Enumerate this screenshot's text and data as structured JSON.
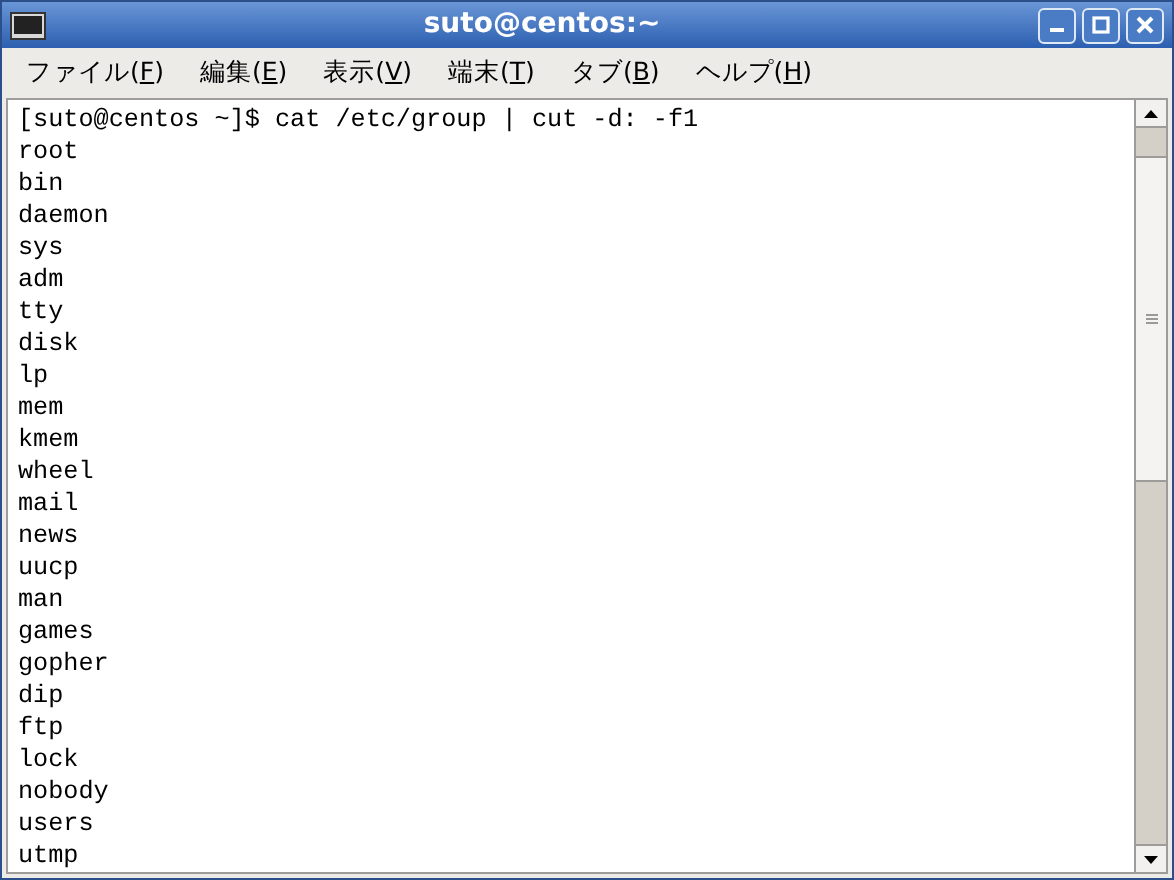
{
  "window": {
    "title": "suto@centos:~"
  },
  "menu": [
    {
      "before": "ファイル(",
      "key": "F",
      "after": ")"
    },
    {
      "before": "編集(",
      "key": "E",
      "after": ")"
    },
    {
      "before": "表示(",
      "key": "V",
      "after": ")"
    },
    {
      "before": "端末(",
      "key": "T",
      "after": ")"
    },
    {
      "before": "タブ(",
      "key": "B",
      "after": ")"
    },
    {
      "before": "ヘルプ(",
      "key": "H",
      "after": ")"
    }
  ],
  "terminal": {
    "lines": [
      "[suto@centos ~]$ cat /etc/group | cut -d: -f1",
      "root",
      "bin",
      "daemon",
      "sys",
      "adm",
      "tty",
      "disk",
      "lp",
      "mem",
      "kmem",
      "wheel",
      "mail",
      "news",
      "uucp",
      "man",
      "games",
      "gopher",
      "dip",
      "ftp",
      "lock",
      "nobody",
      "users",
      "utmp"
    ]
  }
}
